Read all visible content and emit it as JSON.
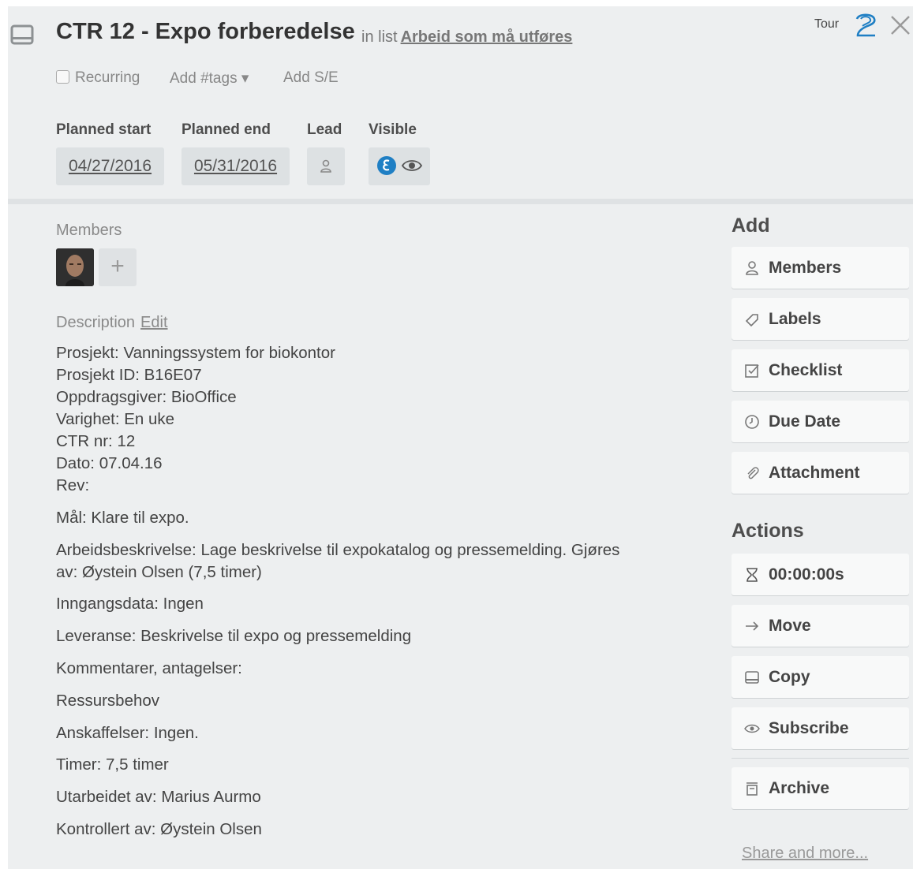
{
  "header": {
    "title": "CTR 12 - Expo forberedelse",
    "in_list_prefix": "in list",
    "list_name": "Arbeid som må utføres",
    "tour_label": "Tour"
  },
  "options": {
    "recurring": "Recurring",
    "add_tags": "Add #tags ▾",
    "add_se": "Add S/E"
  },
  "fields": {
    "planned_start_label": "Planned start",
    "planned_start_value": "04/27/2016",
    "planned_end_label": "Planned end",
    "planned_end_value": "05/31/2016",
    "lead_label": "Lead",
    "visible_label": "Visible"
  },
  "members": {
    "label": "Members",
    "add_symbol": "+"
  },
  "description": {
    "label": "Description",
    "edit_label": "Edit",
    "block1": [
      "Prosjekt: Vanningssystem for biokontor",
      "Prosjekt ID: B16E07",
      "Oppdragsgiver: BioOffice",
      "Varighet: En uke",
      "CTR nr: 12",
      "Dato: 07.04.16",
      "Rev:"
    ],
    "goal": "Mål: Klare til expo.",
    "work_line1": "Arbeidsbeskrivelse: Lage beskrivelse til expokatalog og pressemelding. Gjøres",
    "work_line2": "av: Øystein Olsen (7,5 timer)",
    "input": "Inngangsdata: Ingen",
    "delivery": "Leveranse: Beskrivelse til expo og pressemelding",
    "comments": "Kommentarer, antagelser:",
    "resources": "Ressursbehov",
    "procurement": "Anskaffelser: Ingen.",
    "hours": "Timer: 7,5 timer",
    "prepared_by": "Utarbeidet av: Marius Aurmo",
    "checked_by": "Kontrollert av: Øystein Olsen"
  },
  "sidebar": {
    "add_title": "Add",
    "add_buttons": [
      "Members",
      "Labels",
      "Checklist",
      "Due Date",
      "Attachment"
    ],
    "actions_title": "Actions",
    "timer": "00:00:00s",
    "action_buttons": [
      "Move",
      "Copy",
      "Subscribe"
    ],
    "archive": "Archive",
    "share": "Share and more..."
  },
  "colors": {
    "background": "#edeff0",
    "button": "#f8f9f9",
    "accent_blue": "#1f7fc4"
  }
}
